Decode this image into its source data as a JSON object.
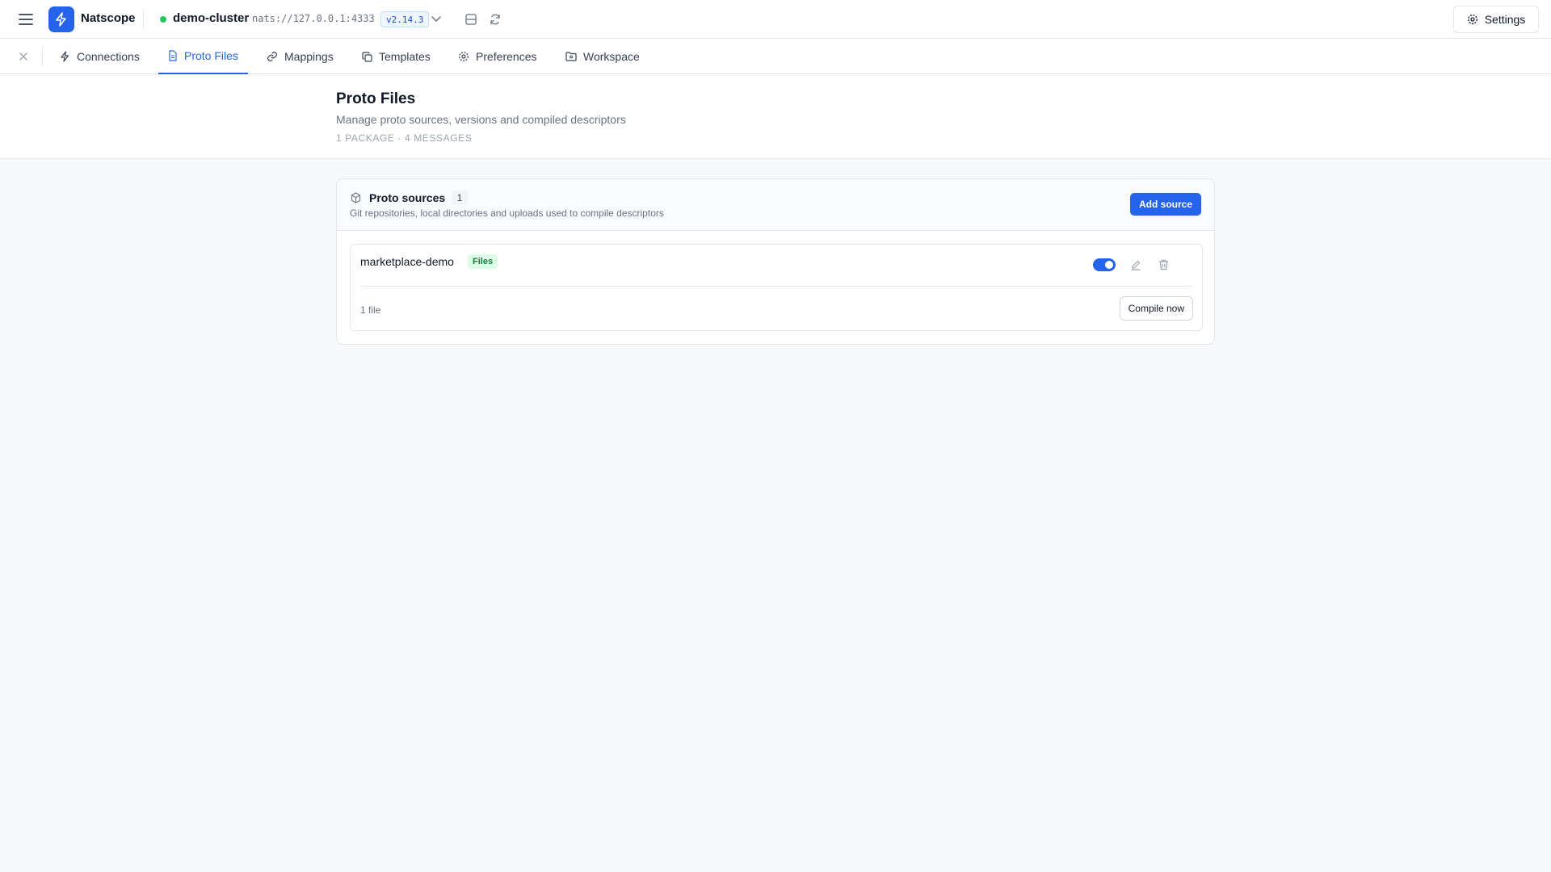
{
  "app": {
    "name": "Natscope"
  },
  "connection": {
    "cluster": "demo-cluster",
    "url": "nats://127.0.0.1:4333",
    "version": "v2.14.3",
    "status_color": "#22c55e"
  },
  "header": {
    "settings_label": "Settings"
  },
  "tabs": [
    {
      "label": "Connections",
      "icon": "zap-icon"
    },
    {
      "label": "Proto Files",
      "icon": "file-icon",
      "active": true
    },
    {
      "label": "Mappings",
      "icon": "link-icon"
    },
    {
      "label": "Templates",
      "icon": "copy-icon"
    },
    {
      "label": "Preferences",
      "icon": "gear-icon"
    },
    {
      "label": "Workspace",
      "icon": "folder-icon"
    }
  ],
  "page": {
    "title": "Proto Files",
    "subtitle": "Manage proto sources, versions and compiled descriptors",
    "meta": "1 PACKAGE · 4 MESSAGES"
  },
  "sources": {
    "title": "Proto sources",
    "count": "1",
    "description": "Git repositories, local directories and uploads used to compile descriptors",
    "add_label": "Add source",
    "items": [
      {
        "name": "marketplace-demo",
        "type_badge": "Files",
        "enabled": true,
        "file_count": "1 file",
        "compile_label": "Compile now"
      }
    ]
  },
  "colors": {
    "accent": "#2563eb",
    "success": "#22c55e"
  }
}
